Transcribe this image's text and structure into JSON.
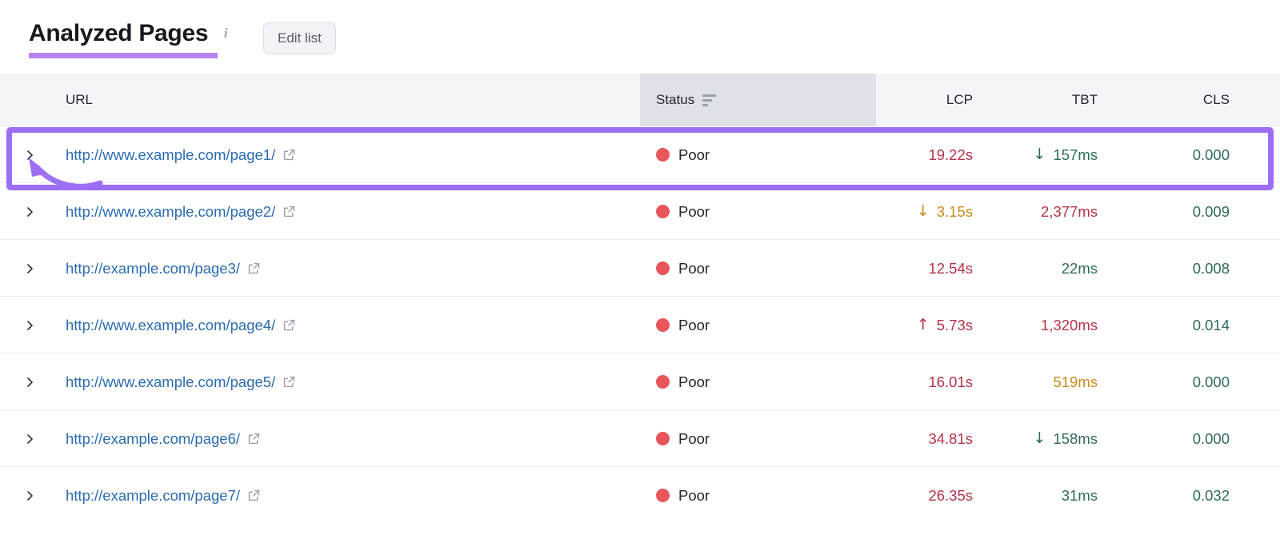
{
  "header": {
    "title": "Analyzed Pages",
    "info_icon": "info-icon",
    "edit_list_label": "Edit list",
    "accent_color": "#b583f0"
  },
  "table": {
    "columns": [
      {
        "key": "url",
        "label": "URL"
      },
      {
        "key": "status",
        "label": "Status",
        "sorted": true,
        "sort_icon": "sort-descending-icon"
      },
      {
        "key": "lcp",
        "label": "LCP"
      },
      {
        "key": "tbt",
        "label": "TBT"
      },
      {
        "key": "cls",
        "label": "CLS"
      }
    ],
    "rows": [
      {
        "expand_icon": "chevron-right-icon",
        "url": "http://www.example.com/page1/",
        "external_icon": "external-link-icon",
        "status": "Poor",
        "status_color": "#e8555a",
        "lcp": "19.22s",
        "lcp_color": "#b3334a",
        "lcp_trend": "",
        "tbt": "157ms",
        "tbt_color": "#2f6b5e",
        "tbt_trend": "↓",
        "cls": "0.000",
        "cls_color": "#2f6b5e"
      },
      {
        "expand_icon": "chevron-right-icon",
        "url": "http://www.example.com/page2/",
        "external_icon": "external-link-icon",
        "status": "Poor",
        "status_color": "#e8555a",
        "lcp": "3.15s",
        "lcp_color": "#c98b1e",
        "lcp_trend": "↓",
        "tbt": "2,377ms",
        "tbt_color": "#b3334a",
        "tbt_trend": "",
        "cls": "0.009",
        "cls_color": "#2f6b5e",
        "highlighted": true
      },
      {
        "expand_icon": "chevron-right-icon",
        "url": "http://example.com/page3/",
        "external_icon": "external-link-icon",
        "status": "Poor",
        "status_color": "#e8555a",
        "lcp": "12.54s",
        "lcp_color": "#b3334a",
        "lcp_trend": "",
        "tbt": "22ms",
        "tbt_color": "#2f6b5e",
        "tbt_trend": "",
        "cls": "0.008",
        "cls_color": "#2f6b5e"
      },
      {
        "expand_icon": "chevron-right-icon",
        "url": "http://www.example.com/page4/",
        "external_icon": "external-link-icon",
        "status": "Poor",
        "status_color": "#e8555a",
        "lcp": "5.73s",
        "lcp_color": "#b3334a",
        "lcp_trend": "↑",
        "tbt": "1,320ms",
        "tbt_color": "#b3334a",
        "tbt_trend": "",
        "cls": "0.014",
        "cls_color": "#2f6b5e"
      },
      {
        "expand_icon": "chevron-right-icon",
        "url": "http://www.example.com/page5/",
        "external_icon": "external-link-icon",
        "status": "Poor",
        "status_color": "#e8555a",
        "lcp": "16.01s",
        "lcp_color": "#b3334a",
        "lcp_trend": "",
        "tbt": "519ms",
        "tbt_color": "#c98b1e",
        "tbt_trend": "",
        "cls": "0.000",
        "cls_color": "#2f6b5e"
      },
      {
        "expand_icon": "chevron-right-icon",
        "url": "http://example.com/page6/",
        "external_icon": "external-link-icon",
        "status": "Poor",
        "status_color": "#e8555a",
        "lcp": "34.81s",
        "lcp_color": "#b3334a",
        "lcp_trend": "",
        "tbt": "158ms",
        "tbt_color": "#2f6b5e",
        "tbt_trend": "↓",
        "cls": "0.000",
        "cls_color": "#2f6b5e"
      },
      {
        "expand_icon": "chevron-right-icon",
        "url": "http://example.com/page7/",
        "external_icon": "external-link-icon",
        "status": "Poor",
        "status_color": "#e8555a",
        "lcp": "26.35s",
        "lcp_color": "#b3334a",
        "lcp_trend": "",
        "tbt": "31ms",
        "tbt_color": "#2f6b5e",
        "tbt_trend": "",
        "cls": "0.032",
        "cls_color": "#2f6b5e"
      }
    ]
  },
  "annotation": {
    "highlight_row_index": 1,
    "highlight_color": "#9b6ef3",
    "arrow_icon": "curved-arrow-annotation",
    "arrow_target": "expand-row-chevron"
  }
}
